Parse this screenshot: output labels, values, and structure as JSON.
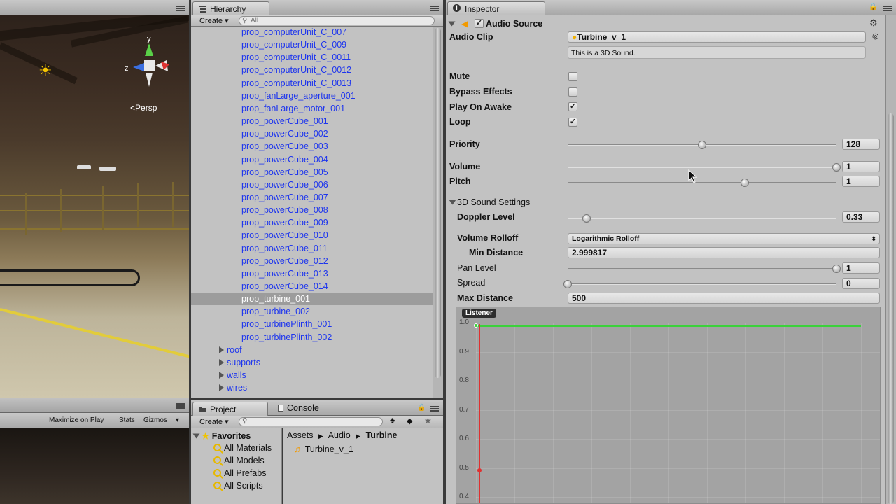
{
  "scene": {
    "persp_label": "Persp",
    "gizmo_labels": {
      "y": "y",
      "z": "z"
    }
  },
  "game_toolbar": {
    "maximize_label": "Maximize on Play",
    "stats_label": "Stats",
    "gizmos_label": "Gizmos"
  },
  "hierarchy": {
    "tab_label": "Hierarchy",
    "create_label": "Create",
    "search_placeholder": "All",
    "items": [
      {
        "label": "prop_computerUnit_C_007",
        "indent": 1
      },
      {
        "label": "prop_computerUnit_C_009",
        "indent": 1
      },
      {
        "label": "prop_computerUnit_C_0011",
        "indent": 1
      },
      {
        "label": "prop_computerUnit_C_0012",
        "indent": 1
      },
      {
        "label": "prop_computerUnit_C_0013",
        "indent": 1
      },
      {
        "label": "prop_fanLarge_aperture_001",
        "indent": 1
      },
      {
        "label": "prop_fanLarge_motor_001",
        "indent": 1
      },
      {
        "label": "prop_powerCube_001",
        "indent": 1
      },
      {
        "label": "prop_powerCube_002",
        "indent": 1
      },
      {
        "label": "prop_powerCube_003",
        "indent": 1
      },
      {
        "label": "prop_powerCube_004",
        "indent": 1
      },
      {
        "label": "prop_powerCube_005",
        "indent": 1
      },
      {
        "label": "prop_powerCube_006",
        "indent": 1
      },
      {
        "label": "prop_powerCube_007",
        "indent": 1
      },
      {
        "label": "prop_powerCube_008",
        "indent": 1
      },
      {
        "label": "prop_powerCube_009",
        "indent": 1
      },
      {
        "label": "prop_powerCube_010",
        "indent": 1
      },
      {
        "label": "prop_powerCube_011",
        "indent": 1
      },
      {
        "label": "prop_powerCube_012",
        "indent": 1
      },
      {
        "label": "prop_powerCube_013",
        "indent": 1
      },
      {
        "label": "prop_powerCube_014",
        "indent": 1
      },
      {
        "label": "prop_turbine_001",
        "indent": 1,
        "selected": true
      },
      {
        "label": "prop_turbine_002",
        "indent": 1
      },
      {
        "label": "prop_turbinePlinth_001",
        "indent": 1
      },
      {
        "label": "prop_turbinePlinth_002",
        "indent": 1
      },
      {
        "label": "roof",
        "indent": 0,
        "folder": true
      },
      {
        "label": "supports",
        "indent": 0,
        "folder": true
      },
      {
        "label": "walls",
        "indent": 0,
        "folder": true
      },
      {
        "label": "wires",
        "indent": 0,
        "folder": true
      }
    ]
  },
  "project": {
    "tab_label": "Project",
    "console_label": "Console",
    "create_label": "Create",
    "favorites_label": "Favorites",
    "favorites": [
      "All Materials",
      "All Models",
      "All Prefabs",
      "All Scripts"
    ],
    "breadcrumb": [
      "Assets",
      "Audio",
      "Turbine"
    ],
    "asset_name": "Turbine_v_1"
  },
  "inspector": {
    "tab_label": "Inspector",
    "component_title": "Audio Source",
    "audio_clip_label": "Audio Clip",
    "audio_clip_value": "Turbine_v_1",
    "clip_info": "This is a 3D Sound.",
    "mute_label": "Mute",
    "bypass_label": "Bypass Effects",
    "play_on_awake_label": "Play On Awake",
    "loop_label": "Loop",
    "mute_checked": false,
    "bypass_checked": false,
    "play_on_awake_checked": true,
    "loop_checked": true,
    "priority_label": "Priority",
    "priority_value": "128",
    "priority_fraction": 0.5,
    "volume_label": "Volume",
    "volume_value": "1",
    "volume_fraction": 1.0,
    "pitch_label": "Pitch",
    "pitch_value": "1",
    "pitch_fraction": 0.66,
    "sound3d_label": "3D Sound Settings",
    "doppler_label": "Doppler Level",
    "doppler_value": "0.33",
    "doppler_fraction": 0.07,
    "rolloff_label": "Volume Rolloff",
    "rolloff_value": "Logarithmic Rolloff",
    "min_distance_label": "Min Distance",
    "min_distance_value": "2.999817",
    "pan_label": "Pan Level",
    "pan_value": "1",
    "pan_fraction": 1.0,
    "spread_label": "Spread",
    "spread_value": "0",
    "spread_fraction": 0.0,
    "max_distance_label": "Max Distance",
    "max_distance_value": "500",
    "graph": {
      "listener_label": "Listener",
      "y_ticks": [
        "1.0",
        "0.9",
        "0.8",
        "0.7",
        "0.6",
        "0.5",
        "0.4"
      ]
    }
  },
  "colors": {
    "hierarchy_link": "#1d35ee",
    "curve_green": "#3bd13b",
    "curve_red": "#e03030",
    "panel_bg": "#c2c2c2"
  }
}
